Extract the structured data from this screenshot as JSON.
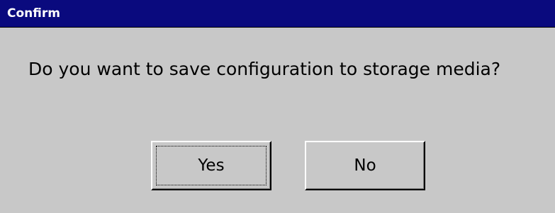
{
  "dialog": {
    "title": "Confirm",
    "message": "Do you want to save configuration to storage media?",
    "buttons": {
      "yes_label": "Yes",
      "no_label": "No"
    },
    "focused_button": "yes"
  },
  "colors": {
    "title_bar_background": "#0A0A7E",
    "title_text": "#FFFFFF",
    "dialog_background": "#C8C8C8",
    "text": "#000000"
  }
}
